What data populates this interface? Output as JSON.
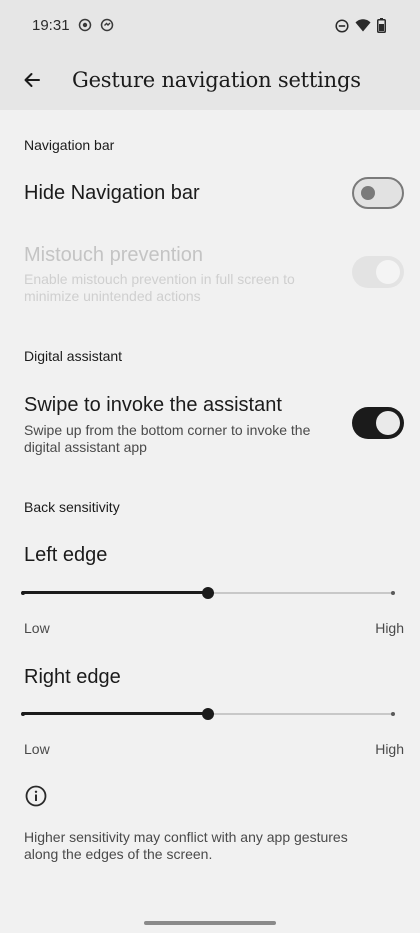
{
  "status_bar": {
    "time": "19:31",
    "icons_left": [
      "record-icon",
      "sync-icon"
    ],
    "icons_right": [
      "dnd-icon",
      "wifi-icon",
      "battery-icon"
    ]
  },
  "app_bar": {
    "title": "Gesture navigation settings",
    "back_icon": "arrow-left-icon"
  },
  "sections": {
    "navigation_bar": {
      "header": "Navigation bar",
      "hide_nav": {
        "title": "Hide Navigation bar",
        "enabled": true,
        "checked": false
      },
      "mistouch": {
        "title": "Mistouch prevention",
        "summary": "Enable mistouch prevention in full screen to minimize unintended actions",
        "enabled": false,
        "checked": true
      }
    },
    "digital_assistant": {
      "header": "Digital assistant",
      "swipe_assistant": {
        "title": "Swipe to invoke the assistant",
        "summary": "Swipe up from the bottom corner to invoke the digital assistant app",
        "enabled": true,
        "checked": true
      }
    },
    "back_sensitivity": {
      "header": "Back sensitivity",
      "left_edge": {
        "title": "Left edge",
        "value_fraction": 0.5,
        "low_label": "Low",
        "high_label": "High"
      },
      "right_edge": {
        "title": "Right edge",
        "value_fraction": 0.5,
        "low_label": "Low",
        "high_label": "High"
      }
    }
  },
  "footer": {
    "info_icon": "info-icon",
    "text": "Higher sensitivity may conflict with any app gestures along the edges of the screen."
  },
  "colors": {
    "background": "#f1f1f1",
    "app_bar": "#e6e6e6",
    "accent": "#1b1b1b",
    "disabled_text": "#c4c4c4"
  }
}
